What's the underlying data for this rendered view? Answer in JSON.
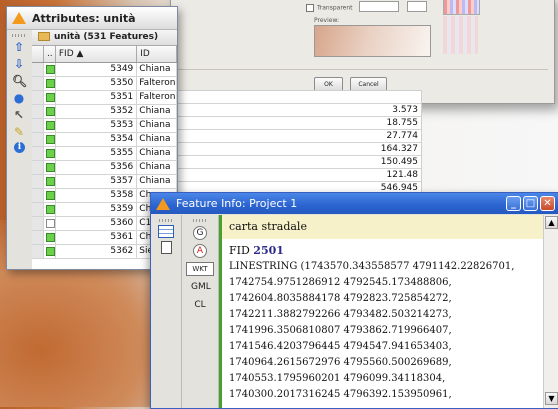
{
  "dialog": {
    "checkbox_label": "Transparent",
    "preview_label": "Preview:",
    "ok_label": "OK",
    "cancel_label": "Cancel"
  },
  "attributes": {
    "title": "Attributes: unità",
    "layer": "unità (531 Features)",
    "col_fid": "FID",
    "col_id": "ID",
    "rows": [
      {
        "fid": "5349",
        "name": "Chiana",
        "selected": true
      },
      {
        "fid": "5350",
        "name": "Falterona",
        "selected": true
      },
      {
        "fid": "5351",
        "name": "Falterona",
        "selected": true
      },
      {
        "fid": "5352",
        "name": "Chiana",
        "selected": true
      },
      {
        "fid": "5353",
        "name": "Chiana",
        "selected": true
      },
      {
        "fid": "5354",
        "name": "Chiana",
        "selected": true
      },
      {
        "fid": "5355",
        "name": "Chiana",
        "selected": true
      },
      {
        "fid": "5356",
        "name": "Chiana",
        "selected": true
      },
      {
        "fid": "5357",
        "name": "Chiana",
        "selected": true
      },
      {
        "fid": "5358",
        "name": "Ch",
        "selected": true
      },
      {
        "fid": "5359",
        "name": "Ch",
        "selected": true
      },
      {
        "fid": "5360",
        "name": "C1",
        "selected": false
      },
      {
        "fid": "5361",
        "name": "Ch",
        "selected": true
      },
      {
        "fid": "5362",
        "name": "Sie",
        "selected": true
      }
    ]
  },
  "values": [
    "3.573",
    "18.755",
    "27.774",
    "164.327",
    "150.495",
    "121.48",
    "546.945"
  ],
  "feature_info": {
    "title": "Feature Info: Project  1",
    "layer_name": "carta stradale",
    "fid_label": "FID",
    "fid_value": "2501",
    "toolbar": {
      "wkt": "WKT",
      "gml": "GML",
      "cl": "CL"
    },
    "geometry_lines": [
      "LINESTRING (1743570.343558577 4791142.22826701,",
      "1742754.9751286912 4792545.173488806,",
      "1742604.8035884178 4792823.725854272,",
      "1742211.3882792266 4793482.503214273,",
      "1741996.3506810807 4793862.719966407,",
      "1741546.4203796445 4794547.941653403,",
      "1740964.2615672976 4795560.500269689,",
      "1740553.1795960201 4796099.34118304,",
      "1740300.2017316245 4796392.153950961,"
    ]
  }
}
